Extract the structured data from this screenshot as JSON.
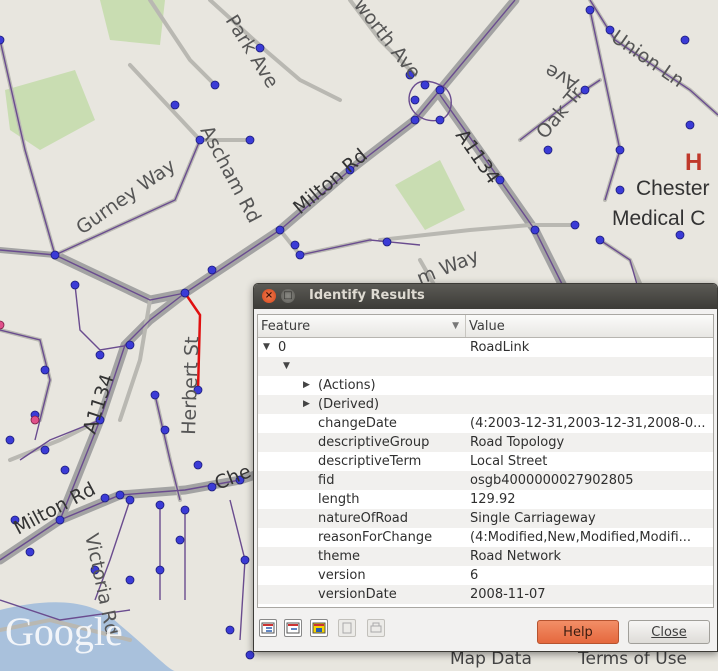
{
  "map": {
    "labels": {
      "park_ave": "Park Ave",
      "worth_ave": "worth Ave",
      "union_ln": "Union Ln",
      "ave_ne": "Ave",
      "oak_tr": "Oak Tr",
      "gurney_way": "Gurney Way",
      "ascham_rd": "Ascham Rd",
      "milton_rd_upper": "Milton Rd",
      "a1134_upper": "A1134",
      "hospital_h": "H",
      "chesterton": "Chester",
      "medical": "Medical C",
      "way_mid": "m Way",
      "herbert_st": "Herbert St",
      "a1134_lower": "A1134",
      "milton_rd_lower": "Milton Rd",
      "victoria_rd": "Victoria Rd",
      "che_rd": "Che",
      "google": "Google",
      "map_data": "Map Data",
      "terms_of_use": "Terms of Use"
    }
  },
  "dialog": {
    "title": "Identify Results",
    "columns": {
      "feature": "Feature",
      "value": "Value"
    },
    "rows": [
      {
        "feature": "0",
        "value": "RoadLink"
      },
      {
        "feature": "",
        "value": ""
      },
      {
        "feature": "(Actions)",
        "value": ""
      },
      {
        "feature": "(Derived)",
        "value": ""
      },
      {
        "feature": "changeDate",
        "value": "(4:2003-12-31,2003-12-31,2008-0..."
      },
      {
        "feature": "descriptiveGroup",
        "value": "Road Topology"
      },
      {
        "feature": "descriptiveTerm",
        "value": "Local Street"
      },
      {
        "feature": "fid",
        "value": "osgb4000000027902805"
      },
      {
        "feature": "length",
        "value": "129.92"
      },
      {
        "feature": "natureOfRoad",
        "value": "Single Carriageway"
      },
      {
        "feature": "reasonForChange",
        "value": "(4:Modified,New,Modified,Modifi..."
      },
      {
        "feature": "theme",
        "value": "Road Network"
      },
      {
        "feature": "version",
        "value": "6"
      },
      {
        "feature": "versionDate",
        "value": "2008-11-07"
      }
    ],
    "buttons": {
      "help": "Help",
      "close": "Close"
    },
    "toolbar_icons": [
      "expand-icon",
      "collapse-icon",
      "highlight-icon",
      "copy-icon",
      "print-icon"
    ]
  },
  "colors": {
    "map_bg": "#e8e6df",
    "road_major": "#9a9a9a",
    "network_line": "#6a4c8f",
    "node": "#3b3bd6",
    "selected_line": "#e01010",
    "park_green": "#c9ddb2",
    "help_button": "#e8734a"
  }
}
